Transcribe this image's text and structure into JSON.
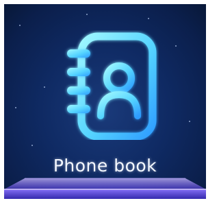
{
  "app": {
    "label": "Phone book",
    "icon": "contacts-book-icon"
  },
  "colors": {
    "background": "#0f2a63",
    "icon_gradient_start": "#8ff3ff",
    "icon_gradient_end": "#2aa8ff",
    "label": "#f4f8ff",
    "platform": "#6a4dff"
  }
}
